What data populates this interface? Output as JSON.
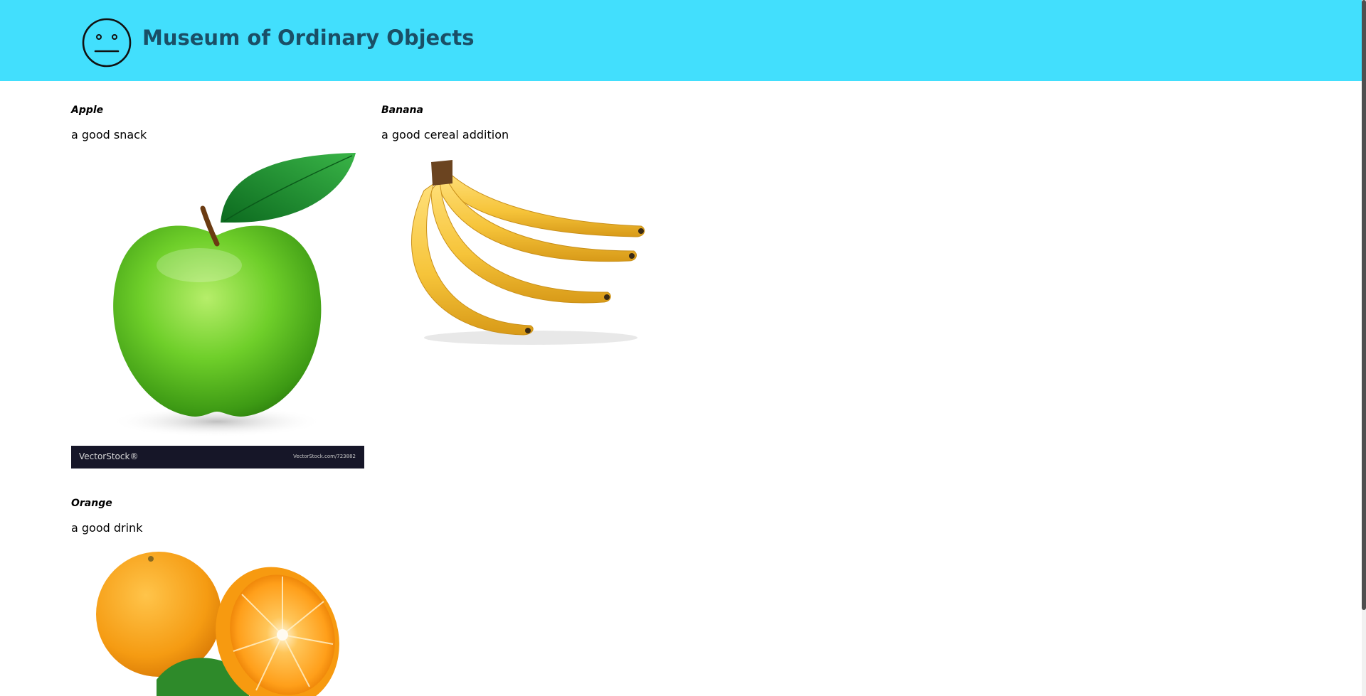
{
  "header": {
    "title": "Museum of Ordinary Objects",
    "background": "#42dffd",
    "logo_icon": "neutral-face-icon"
  },
  "items": [
    {
      "name": "Apple",
      "description": "a good snack",
      "image_icon": "green-apple-image",
      "watermark": {
        "brand": "VectorStock®",
        "code": "VectorStock.com/723882"
      }
    },
    {
      "name": "Banana",
      "description": "a good cereal addition",
      "image_icon": "banana-bunch-image"
    },
    {
      "name": "Orange",
      "description": "a good drink",
      "image_icon": "orange-image"
    }
  ]
}
